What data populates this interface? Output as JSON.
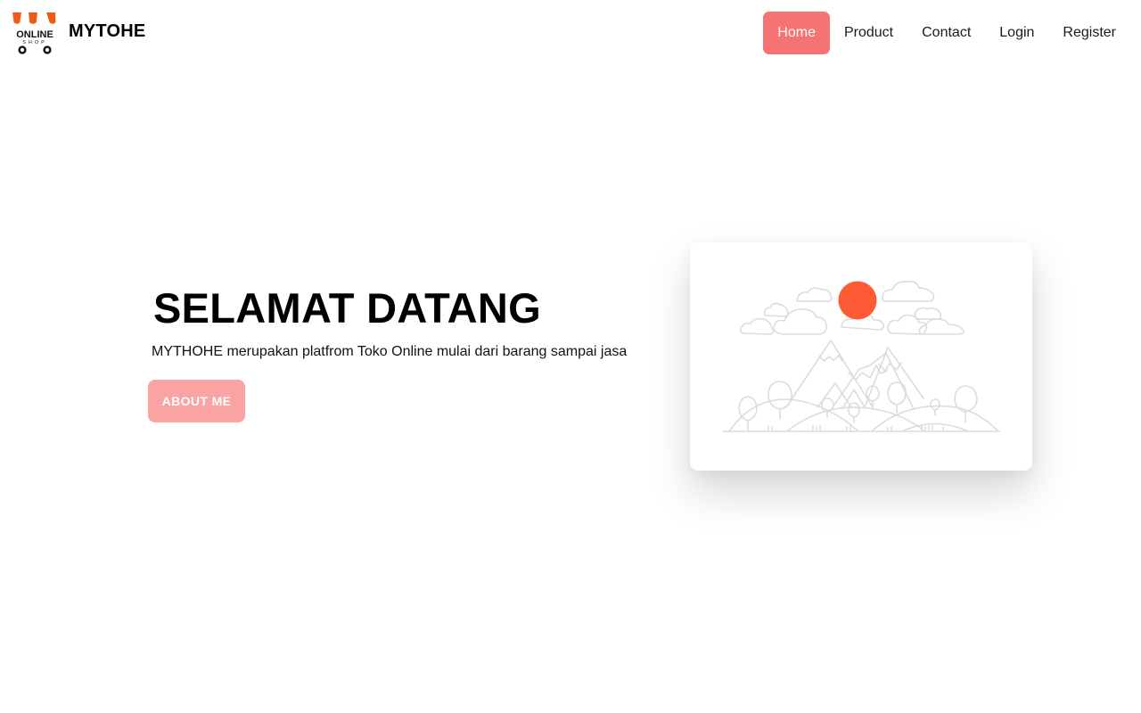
{
  "brand": {
    "logo_text_top": "ONLINE",
    "logo_text_bottom": "SHOP",
    "name": "MYTOHE"
  },
  "nav": {
    "items": [
      {
        "label": "Home",
        "active": true
      },
      {
        "label": "Product",
        "active": false
      },
      {
        "label": "Contact",
        "active": false
      },
      {
        "label": "Login",
        "active": false
      },
      {
        "label": "Register",
        "active": false
      }
    ]
  },
  "hero": {
    "title": "SELAMAT DATANG",
    "description": "MYTHOHE merupakan platfrom Toko Online mulai dari barang sampai jasa",
    "button_label": "ABOUT ME"
  },
  "illustration": {
    "icon": "mountain-landscape-illustration",
    "sun_color": "#ff5a36",
    "line_color": "#dcdcdc"
  },
  "colors": {
    "accent": "#f67373",
    "accent_light": "#f9a3a3",
    "logo_awning": "#f25a14"
  }
}
